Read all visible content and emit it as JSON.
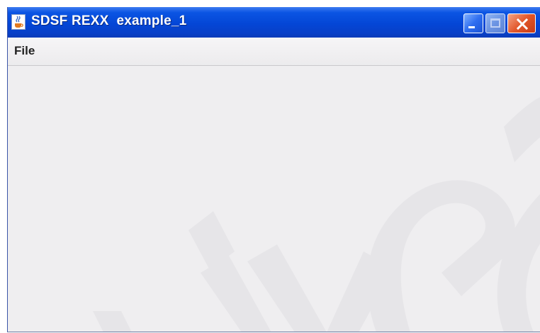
{
  "window": {
    "title": "SDSF REXX  example_1"
  },
  "titlebar": {
    "icon": "java-cup-icon",
    "buttons": {
      "minimize_icon": "minimize-icon",
      "maximize_icon": "maximize-icon",
      "close_icon": "close-icon"
    }
  },
  "menubar": {
    "items": [
      {
        "label": "File"
      }
    ]
  },
  "colors": {
    "titlebar": "#0446d6",
    "menubar": "#ecebed",
    "content": "#efeef0",
    "close_button": "#e2572a"
  }
}
